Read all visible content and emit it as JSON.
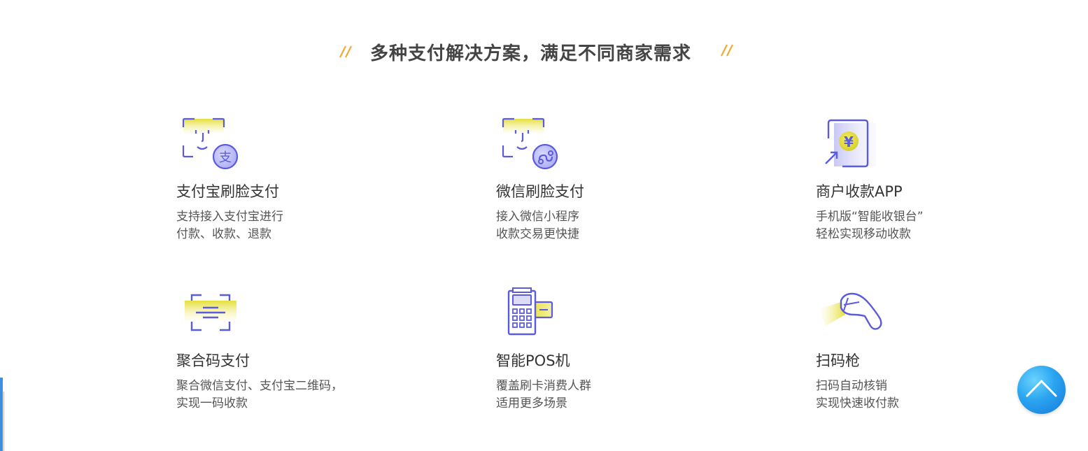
{
  "section": {
    "title": "多种支付解决方案，满足不同商家需求"
  },
  "features": [
    {
      "name": "支付宝刷脸支付",
      "desc_line1": "支持接入支付宝进行",
      "desc_line2": "付款、收款、退款",
      "icon": "alipay-face-icon"
    },
    {
      "name": "微信刷脸支付",
      "desc_line1": "接入微信小程序",
      "desc_line2": "收款交易更快捷",
      "icon": "wechat-face-icon"
    },
    {
      "name": "商户收款APP",
      "desc_line1": "手机版“智能收银台”",
      "desc_line2": "轻松实现移动收款",
      "icon": "mobile-cashier-icon"
    },
    {
      "name": "聚合码支付",
      "desc_line1": "聚合微信支付、支付宝二维码，",
      "desc_line2": "实现一码收款",
      "icon": "qr-scan-icon"
    },
    {
      "name": "智能POS机",
      "desc_line1": "覆盖刷卡消费人群",
      "desc_line2": "适用更多场景",
      "icon": "pos-terminal-icon"
    },
    {
      "name": "扫码枪",
      "desc_line1": "扫码自动核销",
      "desc_line2": "实现快速收付款",
      "icon": "barcode-scanner-icon"
    }
  ],
  "colors": {
    "icon_stroke": "#5b5be0",
    "icon_fill_yellow": "#e9e04a",
    "deco_orange": "#f3a526",
    "back_top_blue": "#1d8ae6"
  },
  "back_to_top": {
    "icon": "chevron-up-icon"
  }
}
